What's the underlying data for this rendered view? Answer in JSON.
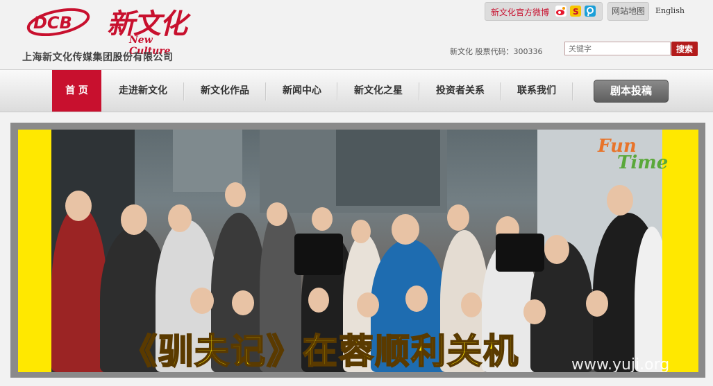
{
  "logo": {
    "mark_text": "DCB",
    "name_cn": "新文化",
    "name_en": "New Culture",
    "company": "上海新文化传媒集团股份有限公司"
  },
  "header": {
    "weibo_label": "新文化官方微博",
    "sitemap": "网站地图",
    "english": "English",
    "stock_label": "新文化 股票代码：300336",
    "search_placeholder": "关键字",
    "search_button": "搜索"
  },
  "nav": {
    "items": [
      {
        "label": "首 页",
        "active": true
      },
      {
        "label": "走进新文化",
        "active": false
      },
      {
        "label": "新文化作品",
        "active": false
      },
      {
        "label": "新闻中心",
        "active": false
      },
      {
        "label": "新文化之星",
        "active": false
      },
      {
        "label": "投资者关系",
        "active": false
      },
      {
        "label": "联系我们",
        "active": false
      }
    ],
    "submit_button": "剧本投稿"
  },
  "banner": {
    "caption": "《驯夫记》在蓉顺利关机",
    "badge_line1": "Fun",
    "badge_line2": "Time",
    "watermark": "www.yuji.org"
  },
  "colors": {
    "brand_red": "#c8102e",
    "banner_yellow": "#ffe800",
    "nav_gray": "#dcdcdc"
  }
}
